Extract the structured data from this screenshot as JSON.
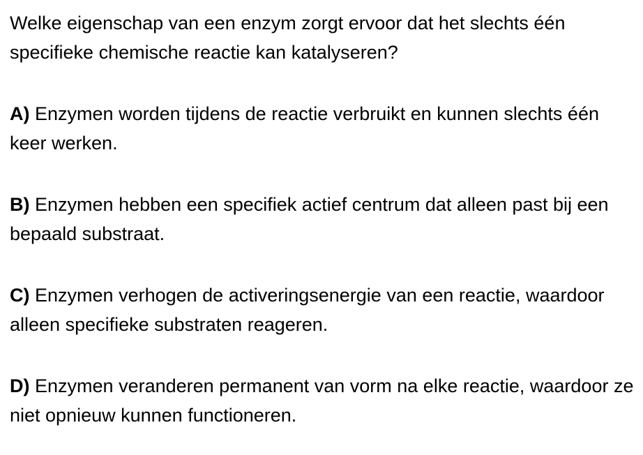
{
  "question": "Welke eigenschap van een enzym zorgt ervoor dat het slechts één specifieke chemische reactie kan katalyseren?",
  "options": [
    {
      "letter": "A)",
      "text": "Enzymen worden tijdens de reactie verbruikt en kunnen slechts één keer werken."
    },
    {
      "letter": "B)",
      "text": "Enzymen hebben een specifiek actief centrum dat alleen past bij een bepaald substraat."
    },
    {
      "letter": "C)",
      "text": "Enzymen verhogen de activeringsenergie van een reactie, waardoor alleen specifieke substraten reageren."
    },
    {
      "letter": "D)",
      "text": "Enzymen veranderen permanent van vorm na elke reactie, waardoor ze niet opnieuw kunnen functioneren."
    }
  ]
}
